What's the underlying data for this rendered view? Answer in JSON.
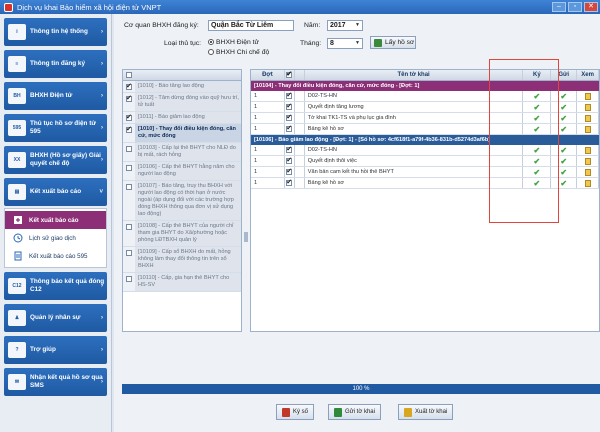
{
  "window": {
    "title": "Dịch vụ khai Bảo hiểm xã hội điện tử VNPT"
  },
  "sidebar": {
    "items": [
      {
        "label": "Thông tin hệ thống",
        "icon": "info-icon"
      },
      {
        "label": "Thông tin đăng ký",
        "icon": "register-icon"
      },
      {
        "label": "BHXH Điện tử",
        "icon": "bhxh-icon"
      },
      {
        "label": "Thủ tục hồ sơ điện tử 595",
        "icon": "procedure-icon"
      },
      {
        "label": "BHXH (Hồ sơ giấy) Giải quyết chế độ",
        "icon": "paper-icon"
      },
      {
        "label": "Kết xuất báo cáo",
        "icon": "report-icon"
      }
    ],
    "sub_items": [
      {
        "label": "Kết xuất báo cáo"
      },
      {
        "label": "Lịch sử giao dịch"
      },
      {
        "label": "Kết xuất báo cáo 595"
      }
    ],
    "items_bottom": [
      {
        "label": "Thông báo kết quả đóng C12",
        "icon": "notice-icon"
      },
      {
        "label": "Quản lý nhân sự",
        "icon": "hr-icon"
      },
      {
        "label": "Trợ giúp",
        "icon": "help-icon"
      },
      {
        "label": "Nhận kết quả hồ sơ qua SMS",
        "icon": "sms-icon"
      }
    ]
  },
  "form": {
    "agency_label": "Cơ quan BHXH đăng ký:",
    "agency_value": "Quận Bắc Từ Liêm",
    "year_label": "Năm:",
    "year_value": "2017",
    "proc_label": "Loại thủ tục:",
    "proc_options": [
      "BHXH Điện tử",
      "BHXH Chi chế độ"
    ],
    "month_label": "Tháng:",
    "month_value": "8",
    "fetch_button": "Lấy hồ sơ"
  },
  "left_list": [
    {
      "text": "[1010] - Báo tăng lao động",
      "checked": true,
      "selected": false
    },
    {
      "text": "[1012] - Tăm dừng đóng vào quỹ hưu trí, tử tuất",
      "checked": true,
      "selected": false
    },
    {
      "text": "[1011] - Báo giảm lao động",
      "checked": true,
      "selected": false
    },
    {
      "text": "[1010] - Thay đổi điều kiện đóng, căn cứ, mức đóng",
      "checked": true,
      "selected": true
    },
    {
      "text": "[10103] - Cấp lại thẻ BHYT cho NLĐ do bị mất, rách hỏng",
      "checked": false,
      "selected": false
    },
    {
      "text": "[10106] - Cấp thẻ BHYT hằng năm cho người lao động",
      "checked": false,
      "selected": false
    },
    {
      "text": "[10107] - Báo tăng, truy thu BHXH với người lao động có thời hạn ở nước ngoài (áp dụng đối với các trường hợp đóng BHXH thông qua đơn vị sử dụng lao động)",
      "checked": false,
      "selected": false
    },
    {
      "text": "[10108] - Cấp thẻ BHYT của người chỉ tham gia BHYT do Xã/phường hoặc phòng LĐTBXH quản lý",
      "checked": false,
      "selected": false
    },
    {
      "text": "[10109] - Cấp sổ BHXH do mất, hỏng không làm thay đổi thông tin trên sổ BHXH",
      "checked": false,
      "selected": false
    },
    {
      "text": "[10110] - Cấp, gia hạn thẻ BHYT cho HS-SV",
      "checked": false,
      "selected": false
    }
  ],
  "grid": {
    "headers": {
      "dot": "Đợt",
      "name": "Tên tờ khai",
      "ky": "Ký",
      "gui": "Gửi",
      "xem": "Xem"
    },
    "group1": "[10104] - Thay đổi điều kiện đóng, căn cứ, mức đóng - [Đợt: 1]",
    "rows1": [
      {
        "dot": "1",
        "name": "D02-TS-HN"
      },
      {
        "dot": "1",
        "name": "Quyết định tăng lương"
      },
      {
        "dot": "1",
        "name": "Tờ khai TK1-TS và phụ lục gia đình"
      },
      {
        "dot": "1",
        "name": "Bảng kê hồ sơ"
      }
    ],
    "group2": "[10106] - Báo giảm lao động - [Đợt: 1] - [Số hồ sơ: 4cf618f1-a79f-4b36-831b-d5274d3af6b]",
    "rows2": [
      {
        "dot": "1",
        "name": "D02-TS-HN"
      },
      {
        "dot": "1",
        "name": "Quyết định thôi việc"
      },
      {
        "dot": "1",
        "name": "Văn bản cam kết thu hồi thẻ BHYT"
      },
      {
        "dot": "1",
        "name": "Bảng kê hồ sơ"
      }
    ]
  },
  "progress": {
    "label": "100 %",
    "value": 1.0
  },
  "buttons": {
    "sign": "Ký số",
    "send": "Gửi tờ khai",
    "export": "Xuất tờ khai"
  },
  "colors": {
    "primary": "#1f5aa3",
    "accent": "#8c2f77",
    "check": "#3fa33f",
    "highlight": "#e0463b"
  }
}
